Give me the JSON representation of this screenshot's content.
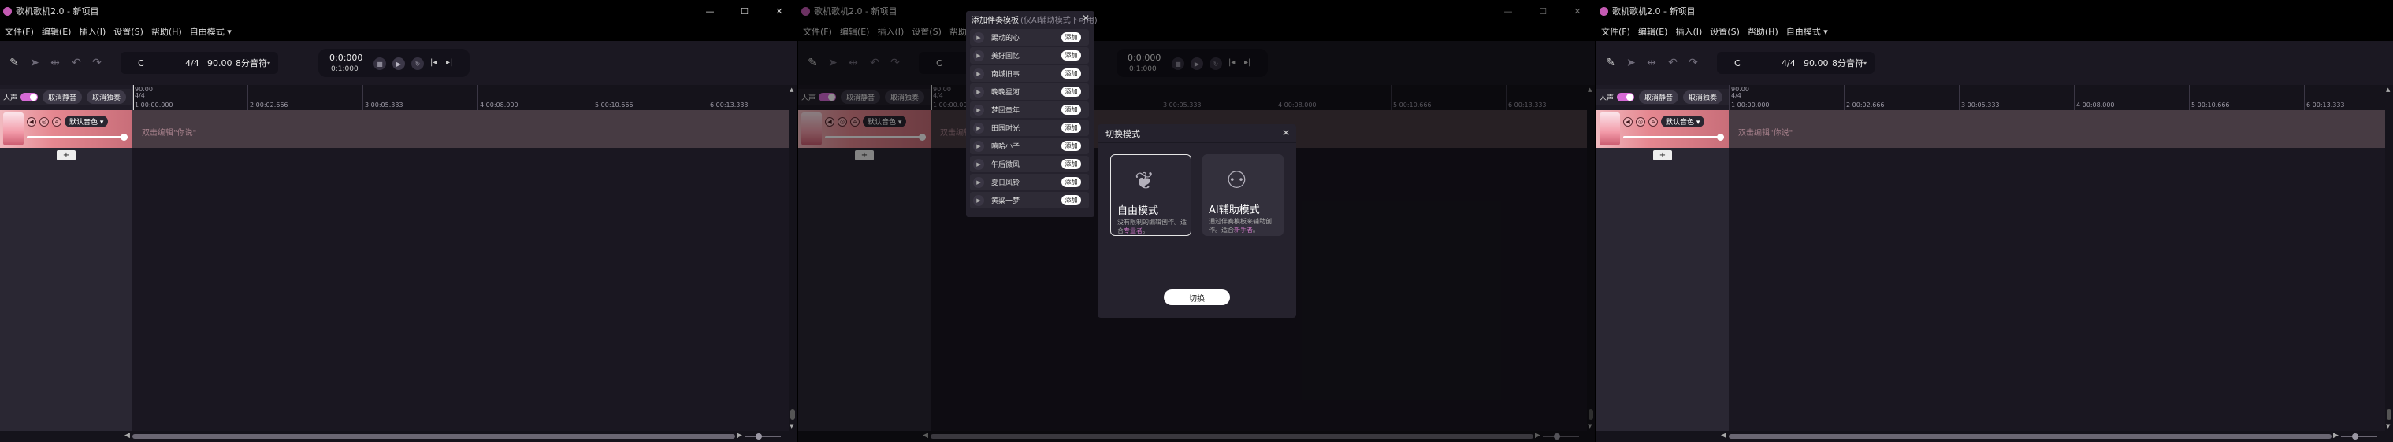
{
  "app": {
    "title": "歌机歌机2.0 - 新项目",
    "controls": [
      "—",
      "☐",
      "✕"
    ]
  },
  "menu": [
    "文件(F)",
    "编辑(E)",
    "插入(I)",
    "设置(S)",
    "帮助(H)",
    "自由模式 ▾"
  ],
  "toolbar": {
    "key": "C",
    "meter": "4/4",
    "tempo": "90.00",
    "duration": "8分音符",
    "dropdown": "▾",
    "tool_icons": [
      "pencil-icon",
      "cursor-icon",
      "split-icon",
      "undo-icon",
      "redo-icon"
    ]
  },
  "transport": {
    "time": "0:0:000",
    "sub": "0:1:000",
    "icons": [
      "stop-icon",
      "play-icon",
      "loop-icon",
      "jump-start-icon",
      "jump-end-icon"
    ]
  },
  "track_controls": {
    "vocal_label": "人声",
    "unmute_label": "取消静音",
    "unsolo_label": "取消独奏"
  },
  "ruler": {
    "labels": [
      "1 00:00.000",
      "2 00:02.666",
      "3 00:05.333",
      "4 00:08.000",
      "5 00:10.666",
      "6 00:13.333"
    ],
    "meter_top": "90.00",
    "meter_bottom": "4/4"
  },
  "track": {
    "voice": "默认音色 ▾",
    "hint": "双击编辑\"你说\"",
    "add": "+"
  },
  "scrollbar": {
    "left": "◀",
    "right": "▶",
    "up": "▲",
    "down": "▼"
  },
  "dialog": {
    "title": "切换模式",
    "close": "✕",
    "mode_free": {
      "title": "自由模式",
      "desc_before": "没有限制的编辑创作。适合",
      "desc_highlight": "专业者",
      "desc_after": "。"
    },
    "mode_ai": {
      "title": "AI辅助模式",
      "desc_before": "通过伴奏模板来辅助创作。适合",
      "desc_highlight": "新手者",
      "desc_after": "。"
    },
    "confirm": "切换"
  },
  "template_panel": {
    "title": "添加伴奏模板",
    "subtitle": "(仅AI辅助模式下可用)",
    "close": "✕",
    "add_label": "添加",
    "items": [
      "踢动的心",
      "美好回忆",
      "南城旧事",
      "晚晚星河",
      "梦回童年",
      "田园时光",
      "嘻哈小子",
      "午后微风",
      "夏日风铃",
      "黄粱一梦"
    ]
  },
  "colors": {
    "accent": "#d66ad5",
    "track": "#e58790",
    "bg": "#1e1b26"
  }
}
